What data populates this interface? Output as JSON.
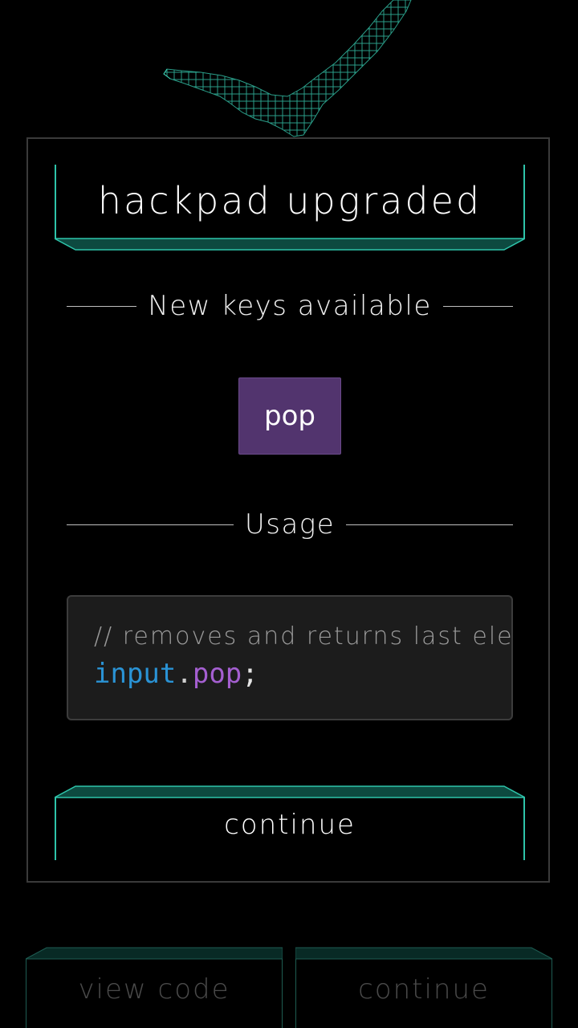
{
  "modal": {
    "title": "hackpad upgraded",
    "new_keys_heading": "New keys available",
    "keys": [
      "pop"
    ],
    "usage_heading": "Usage",
    "code": {
      "comment": "// removes and returns last ele",
      "identifier": "input",
      "dot": ".",
      "method": "pop",
      "terminator": ";"
    },
    "continue_label": "continue"
  },
  "footer": {
    "view_code_label": "view code",
    "continue_label": "continue"
  },
  "colors": {
    "accent_teal": "#2ec4aa",
    "key_chip": "#52346e",
    "code_identifier": "#2a93d5",
    "code_method": "#a45fd0"
  }
}
